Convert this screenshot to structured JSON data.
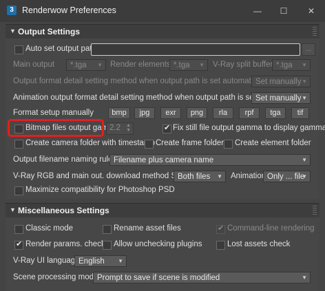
{
  "window": {
    "title": "Renderwow Preferences",
    "minimize": "—",
    "maximize": "☐",
    "close": "✕"
  },
  "output": {
    "section_title": "Output Settings",
    "auto_set_output_path": "Auto set output path",
    "auto_set_output_path_value": "",
    "browse": "...",
    "main_output_label": "Main output",
    "main_output_value": "*.tga",
    "render_elements_label": "Render elements",
    "render_elements_value": "*.tga",
    "vray_split_label": "V-Ray split buffer",
    "vray_split_value": "*.tga",
    "auto_format_method_label": "Output format detail setting method when output path is set automatically",
    "auto_format_method_value": "Set manually",
    "anim_format_method_label": "Animation output format detail setting method when output path is set manual",
    "anim_format_method_value": "Set manually",
    "format_setup_label": "Format setup manually",
    "formats": [
      "bmp",
      "jpg",
      "exr",
      "png",
      "rla",
      "rpf",
      "tga",
      "tif"
    ],
    "bitmap_gamma_label": "Bitmap files output gamma",
    "bitmap_gamma_value": "2.2",
    "fix_still_gamma_label": "Fix still file output gamma to display gamma",
    "create_camera_folder": "Create camera folder with timestamp",
    "create_frame_folder": "Create frame folder",
    "create_element_folder": "Create element folder",
    "naming_rule_label": "Output filename naming rule",
    "naming_rule_value": "Filename plus camera name",
    "download_method_label": "V-Ray RGB and main out. download method Still",
    "still_value": "Both files",
    "animation_label": "Animation",
    "animation_value": "Only ... file",
    "max_compat": "Maximize compatibility for Photoshop PSD"
  },
  "misc": {
    "section_title": "Miscellaneous Settings",
    "classic_mode": "Classic mode",
    "rename_asset_files": "Rename asset files",
    "command_line_rendering": "Command-line rendering",
    "render_params_check": "Render params. check",
    "allow_unchecking_plugins": "Allow unchecking plugins",
    "lost_assets_check": "Lost assets check",
    "ui_language_label": "V-Ray UI language",
    "ui_language_value": "English",
    "scene_modes_label": "Scene processing modes",
    "scene_modes_value": "Prompt to save if scene is modified"
  }
}
